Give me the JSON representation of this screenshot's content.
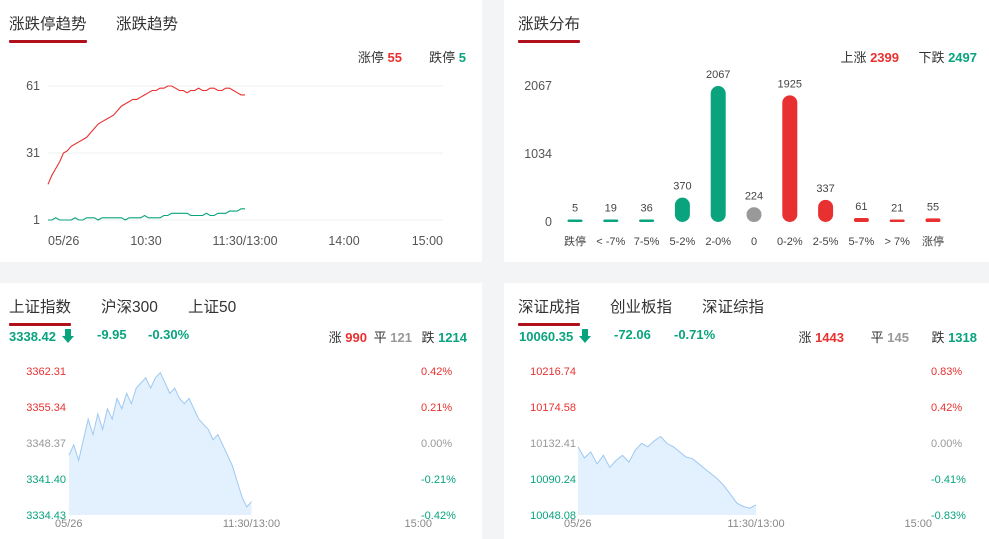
{
  "limit_panel": {
    "tabs": [
      {
        "label": "涨跌停趋势"
      },
      {
        "label": "涨跌趋势"
      }
    ],
    "zhangting_label": "涨停",
    "zhangting_value": "55",
    "dieting_label": "跌停",
    "dieting_value": "5"
  },
  "dist_panel": {
    "tabs": [
      {
        "label": "涨跌分布"
      }
    ],
    "up_label": "上涨",
    "up_value": "2399",
    "down_label": "下跌",
    "down_value": "2497"
  },
  "sh_panel": {
    "tabs": [
      {
        "label": "上证指数"
      },
      {
        "label": "沪深300"
      },
      {
        "label": "上证50"
      }
    ],
    "price": "3338.42",
    "change": "-9.95",
    "change_pct": "-0.30%",
    "up_label": "涨",
    "up_value": "990",
    "flat_label": "平",
    "flat_value": "121",
    "down_label": "跌",
    "down_value": "1214"
  },
  "sz_panel": {
    "tabs": [
      {
        "label": "深证成指"
      },
      {
        "label": "创业板指"
      },
      {
        "label": "深证综指"
      }
    ],
    "price": "10060.35",
    "change": "-72.06",
    "change_pct": "-0.71%",
    "up_label": "涨",
    "up_value": "1443",
    "flat_label": "平",
    "flat_value": "145",
    "down_label": "跌",
    "down_value": "1318"
  },
  "colors": {
    "red": "#e93030",
    "green": "#09a37e",
    "gray": "#999999",
    "accent": "#b0101b",
    "area_fill": "#e3f0fd",
    "area_line": "#9ec9f2"
  },
  "chart_data": [
    {
      "type": "line",
      "x_labels": [
        "05/26",
        "10:30",
        "11:30/13:00",
        "14:00",
        "15:00"
      ],
      "y_ticks": [
        "61",
        "31",
        "1"
      ],
      "ylim": [
        1,
        61
      ],
      "series": [
        {
          "name": "涨停",
          "color": "#e93030",
          "values": [
            17,
            21,
            24,
            27,
            31,
            32,
            34,
            35,
            36,
            37,
            38,
            40,
            42,
            44,
            45,
            46,
            47,
            48,
            50,
            52,
            53,
            54,
            55,
            55,
            56,
            57,
            58,
            59,
            59,
            60,
            60,
            61,
            61,
            60,
            59,
            59,
            58,
            59,
            59,
            60,
            59,
            59,
            60,
            60,
            59,
            59,
            60,
            60,
            59,
            58,
            57,
            57
          ]
        },
        {
          "name": "跌停",
          "color": "#09a37e",
          "values": [
            1,
            1,
            2,
            1,
            1,
            1,
            1,
            2,
            1,
            1,
            2,
            2,
            2,
            1,
            2,
            2,
            2,
            2,
            2,
            2,
            1,
            2,
            2,
            2,
            2,
            3,
            2,
            2,
            2,
            2,
            3,
            3,
            4,
            4,
            4,
            4,
            4,
            3,
            3,
            3,
            3,
            4,
            3,
            3,
            4,
            4,
            4,
            5,
            5,
            5,
            6,
            6
          ]
        }
      ]
    },
    {
      "type": "bar",
      "categories": [
        "跌停",
        "< -7%",
        "7-5%",
        "5-2%",
        "2-0%",
        "0",
        "0-2%",
        "2-5%",
        "5-7%",
        "> 7%",
        "涨停"
      ],
      "values": [
        5,
        19,
        36,
        370,
        2067,
        224,
        1925,
        337,
        61,
        21,
        55
      ],
      "value_labels": [
        "5",
        "19",
        "36",
        "370",
        "2067",
        "224",
        "1925",
        "337",
        "61",
        "21",
        "55"
      ],
      "bar_colors": [
        "#09a37e",
        "#09a37e",
        "#09a37e",
        "#09a37e",
        "#09a37e",
        "#999999",
        "#e93030",
        "#e93030",
        "#e93030",
        "#e93030",
        "#e93030"
      ],
      "y_ticks": [
        "2067",
        "1034",
        "0"
      ],
      "ylim": [
        0,
        2067
      ]
    },
    {
      "type": "area",
      "x_labels": [
        "05/26",
        "11:30/13:00",
        "15:00"
      ],
      "y_ticks": [
        "3362.31",
        "3355.34",
        "3348.37",
        "3341.40",
        "3334.43"
      ],
      "pct_ticks": [
        "0.42%",
        "0.21%",
        "0.00%",
        "-0.21%",
        "-0.42%"
      ],
      "ylim": [
        3334.43,
        3362.31
      ],
      "values": [
        3346,
        3348,
        3345,
        3349,
        3353,
        3350,
        3354,
        3351,
        3355,
        3353,
        3357,
        3355,
        3358,
        3356,
        3359,
        3360,
        3361,
        3359,
        3361,
        3362,
        3360,
        3358,
        3359,
        3357,
        3356,
        3357,
        3355,
        3353,
        3352,
        3351,
        3349,
        3350,
        3348,
        3346,
        3344,
        3341,
        3338,
        3336,
        3337
      ]
    },
    {
      "type": "area",
      "x_labels": [
        "05/26",
        "11:30/13:00",
        "15:00"
      ],
      "y_ticks": [
        "10216.74",
        "10174.58",
        "10132.41",
        "10090.24",
        "10048.08"
      ],
      "pct_ticks": [
        "0.83%",
        "0.42%",
        "0.00%",
        "-0.41%",
        "-0.83%"
      ],
      "ylim": [
        10048.08,
        10216.74
      ],
      "values": [
        10128,
        10115,
        10122,
        10108,
        10118,
        10104,
        10112,
        10118,
        10110,
        10124,
        10132,
        10128,
        10135,
        10140,
        10132,
        10128,
        10122,
        10116,
        10114,
        10108,
        10102,
        10096,
        10090,
        10082,
        10072,
        10062,
        10058,
        10056,
        10060
      ]
    }
  ]
}
